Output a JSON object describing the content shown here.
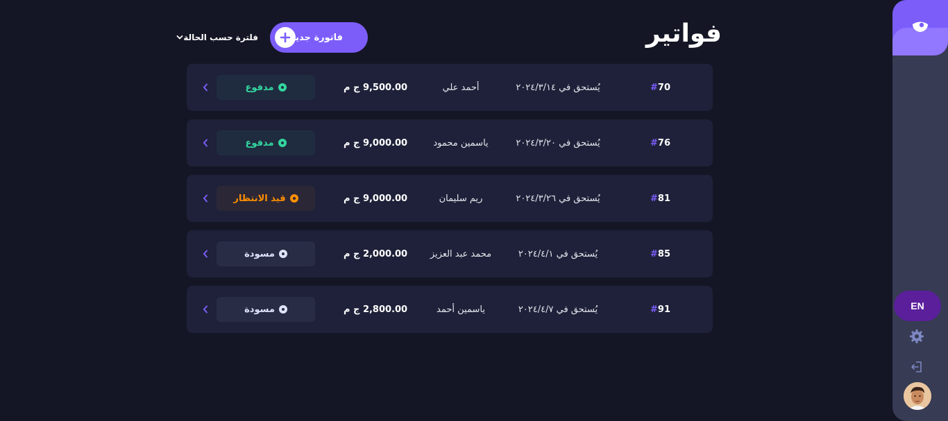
{
  "page": {
    "title": "فواتير"
  },
  "header": {
    "new_invoice_label": "فاتورة جديدة",
    "filter_label": "فلترة حسب الحالة"
  },
  "sidebar": {
    "language_label": "EN",
    "icons": [
      "logo-icon",
      "gear-icon",
      "logout-icon",
      "avatar"
    ]
  },
  "colors": {
    "background": "#141625",
    "card": "#1e2139",
    "accent": "#7c5dfa",
    "paid": "#33d69f",
    "pending": "#ff8f00",
    "draft": "#e0e4fa"
  },
  "invoices": [
    {
      "hash": "#",
      "id": "70",
      "due": "يُستحق في ٢٠٢٤/٣/١٤",
      "name": "أحمد علي",
      "amount": "9,500.00 ج م",
      "status": "مدفوع",
      "status_type": "paid"
    },
    {
      "hash": "#",
      "id": "76",
      "due": "يُستحق في ٢٠٢٤/٣/٢٠",
      "name": "ياسمين محمود",
      "amount": "9,000.00 ج م",
      "status": "مدفوع",
      "status_type": "paid"
    },
    {
      "hash": "#",
      "id": "81",
      "due": "يُستحق في ٢٠٢٤/٣/٢٦",
      "name": "ريم سليمان",
      "amount": "9,000.00 ج م",
      "status": "قيد الانتظار",
      "status_type": "pending"
    },
    {
      "hash": "#",
      "id": "85",
      "due": "يُستحق في ٢٠٢٤/٤/١",
      "name": "محمد عبد العزيز",
      "amount": "2,000.00 ج م",
      "status": "مسودة",
      "status_type": "draft"
    },
    {
      "hash": "#",
      "id": "91",
      "due": "يُستحق في ٢٠٢٤/٤/٧",
      "name": "ياسمين أحمد",
      "amount": "2,800.00 ج م",
      "status": "مسودة",
      "status_type": "draft"
    }
  ]
}
